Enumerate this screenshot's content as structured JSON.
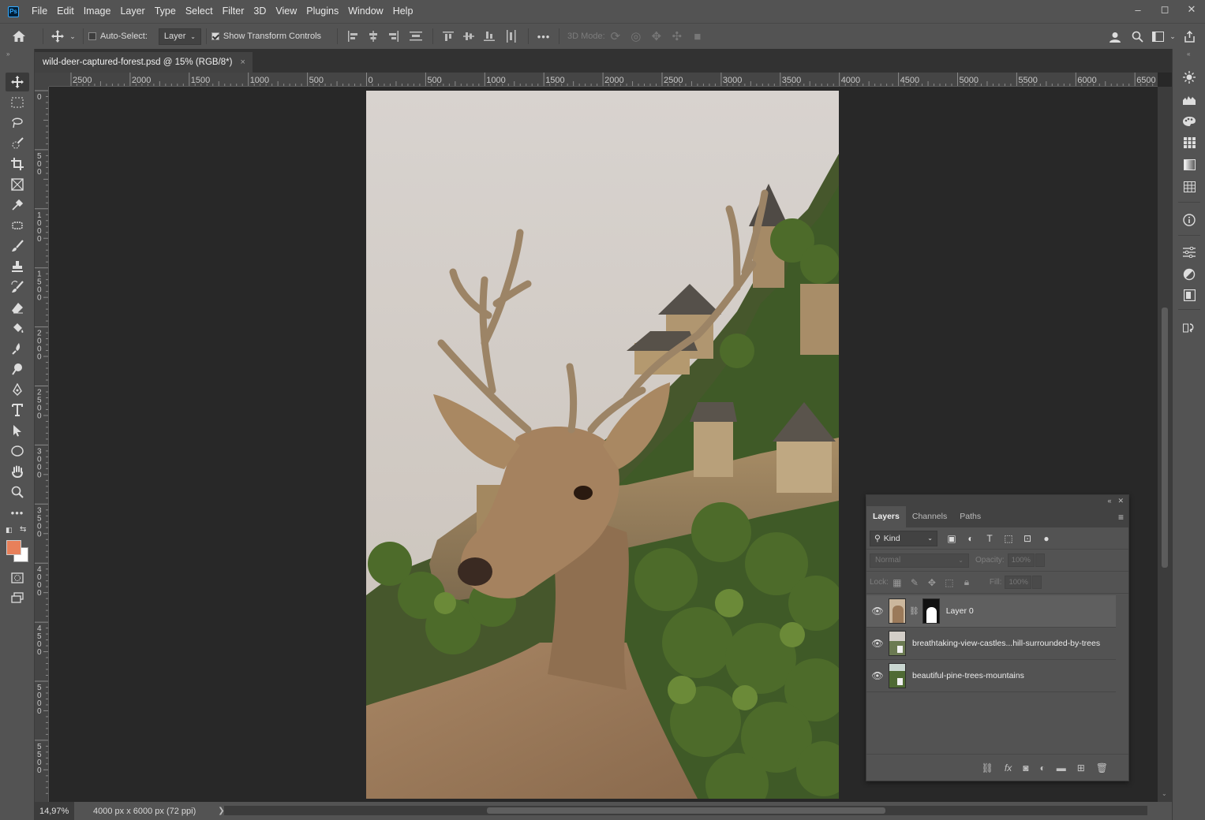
{
  "menubar": {
    "logo": "Ps",
    "items": [
      "File",
      "Edit",
      "Image",
      "Layer",
      "Type",
      "Select",
      "Filter",
      "3D",
      "View",
      "Plugins",
      "Window",
      "Help"
    ],
    "window_controls": [
      "–",
      "◻",
      "✕"
    ]
  },
  "options": {
    "auto_select_label": "Auto-Select:",
    "auto_select_checked": false,
    "target_select": "Layer",
    "show_transform_label": "Show Transform Controls",
    "show_transform_checked": true,
    "more": "•••",
    "mode_3d_label": "3D Mode:"
  },
  "document": {
    "tab_title": "wild-deer-captured-forest.psd @ 15% (RGB/8*)",
    "close_glyph": "×"
  },
  "ruler": {
    "horizontal_labels": [
      "2500",
      "2000",
      "1500",
      "1000",
      "500",
      "0",
      "500",
      "1000",
      "1500",
      "2000",
      "2500",
      "3000",
      "3500",
      "4000",
      "4500",
      "5000",
      "5500",
      "6000",
      "6500"
    ],
    "vertical_labels": [
      "0",
      "500",
      "1000",
      "1500",
      "2000",
      "2500",
      "3000",
      "3500",
      "4000",
      "4500",
      "5000",
      "5500"
    ]
  },
  "status": {
    "zoom": "14,97%",
    "doc_info": "4000 px x 6000 px (72 ppi)",
    "arrow": "❯"
  },
  "colors": {
    "foreground": "#e8805a",
    "background": "#ffffff",
    "accent": "#31a8ff"
  },
  "layers_panel": {
    "tabs": [
      "Layers",
      "Channels",
      "Paths"
    ],
    "active_tab": "Layers",
    "filter_kind": "Kind",
    "blend_mode": "Normal",
    "opacity_label": "Opacity:",
    "opacity_value": "100%",
    "lock_label": "Lock:",
    "fill_label": "Fill:",
    "fill_value": "100%",
    "layers": [
      {
        "name": "Layer 0",
        "visible": true,
        "selected": true
      },
      {
        "name": "breathtaking-view-castles...hill-surrounded-by-trees",
        "visible": true,
        "selected": false
      },
      {
        "name": "beautiful-pine-trees-mountains",
        "visible": true,
        "selected": false
      }
    ]
  }
}
